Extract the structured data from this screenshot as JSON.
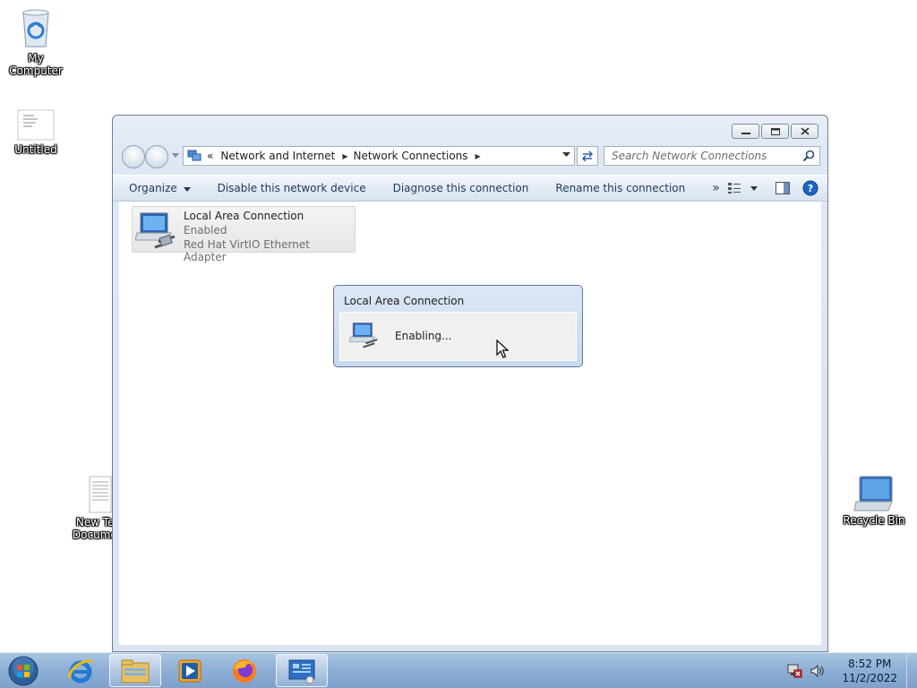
{
  "desktop": {
    "icons": [
      {
        "label": "My Computer",
        "icon": "recycle-bin-icon"
      },
      {
        "label": "Untitled",
        "icon": "document-icon"
      },
      {
        "label": "New Text Document",
        "icon": "text-file-icon"
      },
      {
        "label": "Recycle Bin",
        "icon": "computer-icon"
      }
    ]
  },
  "window": {
    "address": {
      "overflow": "«",
      "segments": [
        "Network and Internet",
        "Network Connections"
      ]
    },
    "search_placeholder": "Search Network Connections",
    "toolbar": {
      "organize": "Organize",
      "disable": "Disable this network device",
      "diagnose": "Diagnose this connection",
      "rename": "Rename this connection",
      "more": "»"
    },
    "connection": {
      "name": "Local Area Connection",
      "status": "Enabled",
      "adapter": "Red Hat VirtIO Ethernet Adapter"
    }
  },
  "dialog": {
    "title": "Local Area Connection",
    "message": "Enabling..."
  },
  "taskbar": {
    "apps": [
      "start-orb",
      "internet-explorer",
      "windows-explorer",
      "media-player",
      "firefox",
      "control-panel"
    ],
    "clock_time": "8:52 PM",
    "clock_date": "11/2/2022"
  },
  "colors": {
    "taskbar": "#8fb0d6",
    "window_frame": "#dbe5f0",
    "toolbar_text": "#1e395b",
    "help_blue": "#1f63c6"
  }
}
